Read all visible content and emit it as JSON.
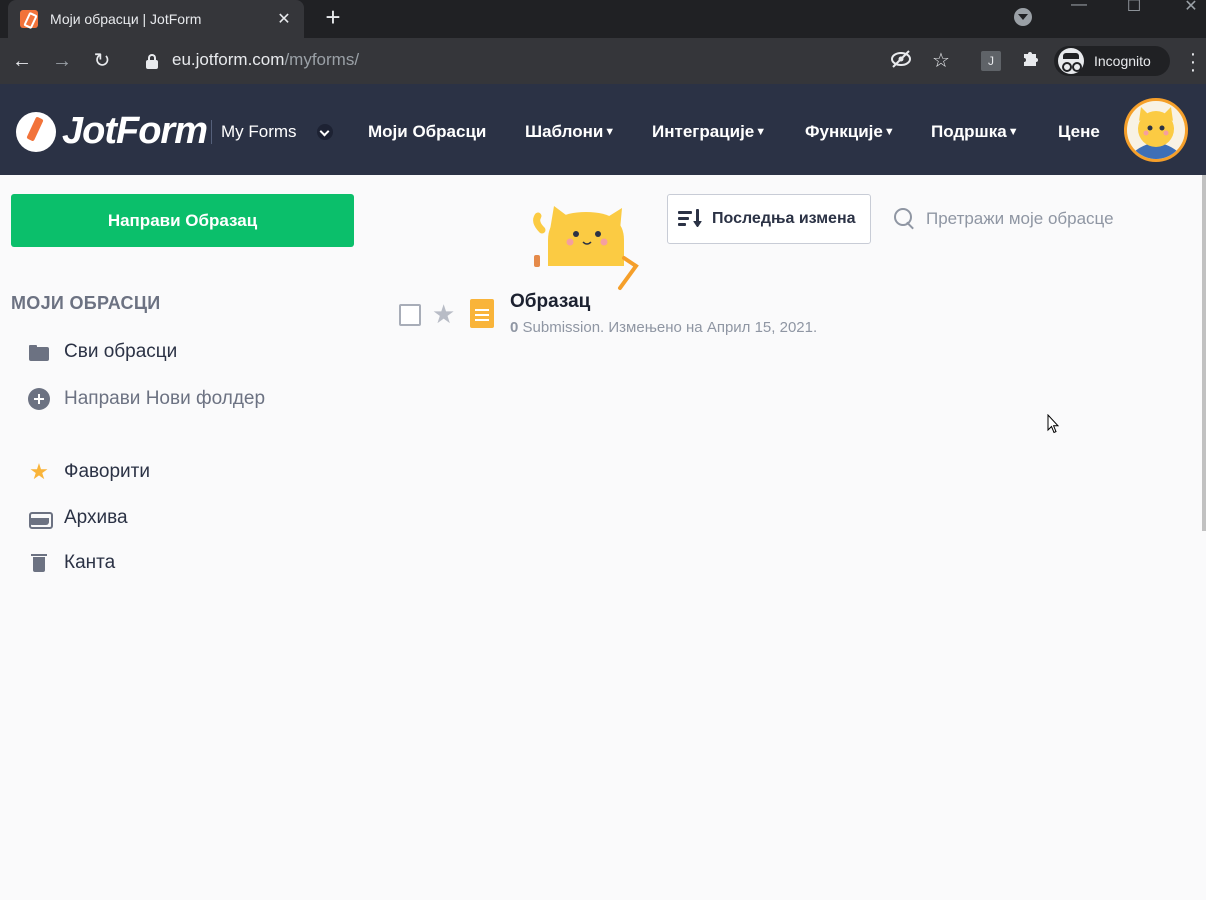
{
  "browser": {
    "tab_title": "Моји обрасци | JotForm",
    "tab_close": "✕",
    "new_tab": "+",
    "url_host": "eu.jotform.com",
    "url_path": "/myforms/",
    "extension_label": "J",
    "incognito_label": "Incognito",
    "icons": [
      "back-icon",
      "forward-icon",
      "reload-icon",
      "lock-icon",
      "eye-off-icon",
      "star-icon",
      "puzzle-icon",
      "incognito-icon",
      "menu-icon"
    ]
  },
  "header": {
    "logo_text": "JotForm",
    "myforms_label": "My Forms",
    "nav": [
      {
        "label": "Моји Обрасци",
        "caret": ""
      },
      {
        "label": "Шаблони",
        "caret": "▼"
      },
      {
        "label": "Интеграције",
        "caret": "▼"
      },
      {
        "label": "Функције",
        "caret": "▼"
      },
      {
        "label": "Подршка",
        "caret": "▼"
      },
      {
        "label": "Цене",
        "caret": ""
      }
    ]
  },
  "sidebar": {
    "create_button": "Направи Образац",
    "heading": "МОЈИ ОБРАСЦИ",
    "items": [
      {
        "label": "Сви обрасци",
        "icon": "folder-icon"
      },
      {
        "label": "Направи Нови фолдер",
        "icon": "plus-circle-icon"
      },
      {
        "label": "Фаворити",
        "icon": "star-icon"
      },
      {
        "label": "Архива",
        "icon": "archive-icon"
      },
      {
        "label": "Канта",
        "icon": "trash-icon"
      }
    ]
  },
  "toolbar": {
    "sort_label": "Последња измена",
    "search_placeholder": "Претражи моје обрасце"
  },
  "forms": [
    {
      "title": "Образац",
      "submissions": "0",
      "meta": "Submission. Измењено на Април 15, 2021."
    }
  ],
  "colors": {
    "header_bg": "#2b3245",
    "create_button": "#0bbf6b",
    "accent_star": "#f9b43a"
  }
}
